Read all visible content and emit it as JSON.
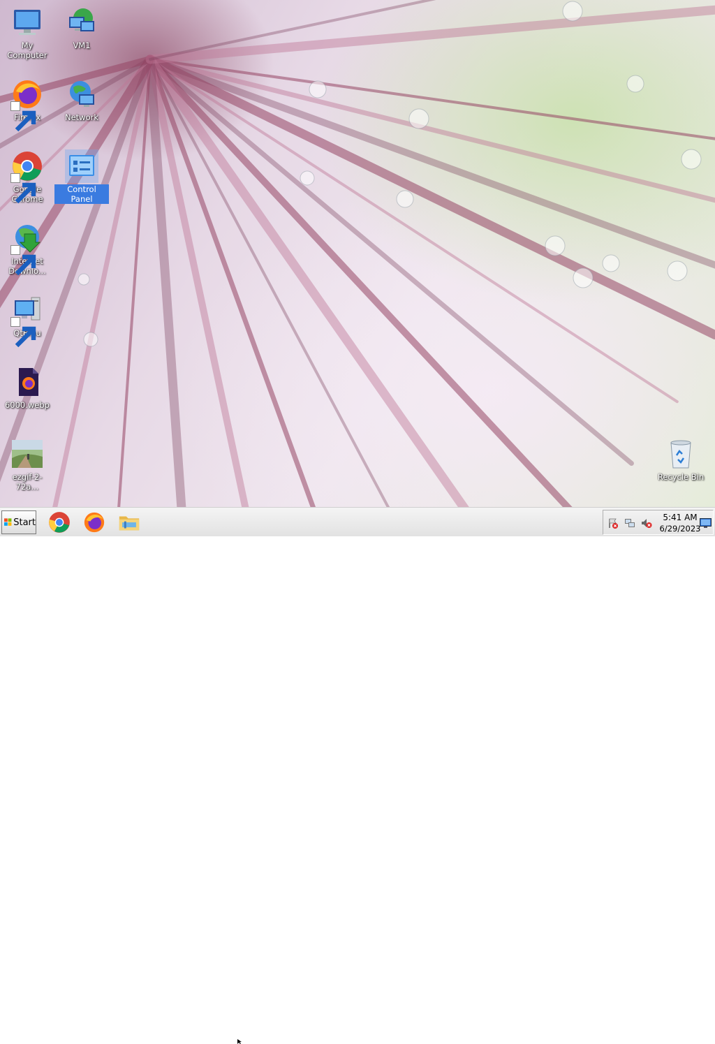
{
  "desktop": {
    "icons": [
      {
        "label": "My Computer"
      },
      {
        "label": "VM1"
      },
      {
        "label": "Firefox"
      },
      {
        "label": "Network"
      },
      {
        "label": "Google\nChrome"
      },
      {
        "label": "Control Panel"
      },
      {
        "label": "Internet\nDownlo..."
      },
      {
        "label": "QtEmu"
      },
      {
        "label": "6000.webp"
      },
      {
        "label": "ezgif-2-72a..."
      },
      {
        "label": "Recycle Bin"
      }
    ]
  },
  "taskbar": {
    "start_label": "Start",
    "pinned": [
      "chrome-icon",
      "firefox-icon",
      "file-explorer-icon"
    ]
  },
  "tray": {
    "icons": [
      "action-center-flag-icon",
      "network-icon",
      "volume-muted-icon"
    ],
    "time": "5:41 AM",
    "date": "6/29/2023"
  },
  "colors": {
    "selection": "#3a7be0",
    "taskbar": "#e8e8e8"
  }
}
